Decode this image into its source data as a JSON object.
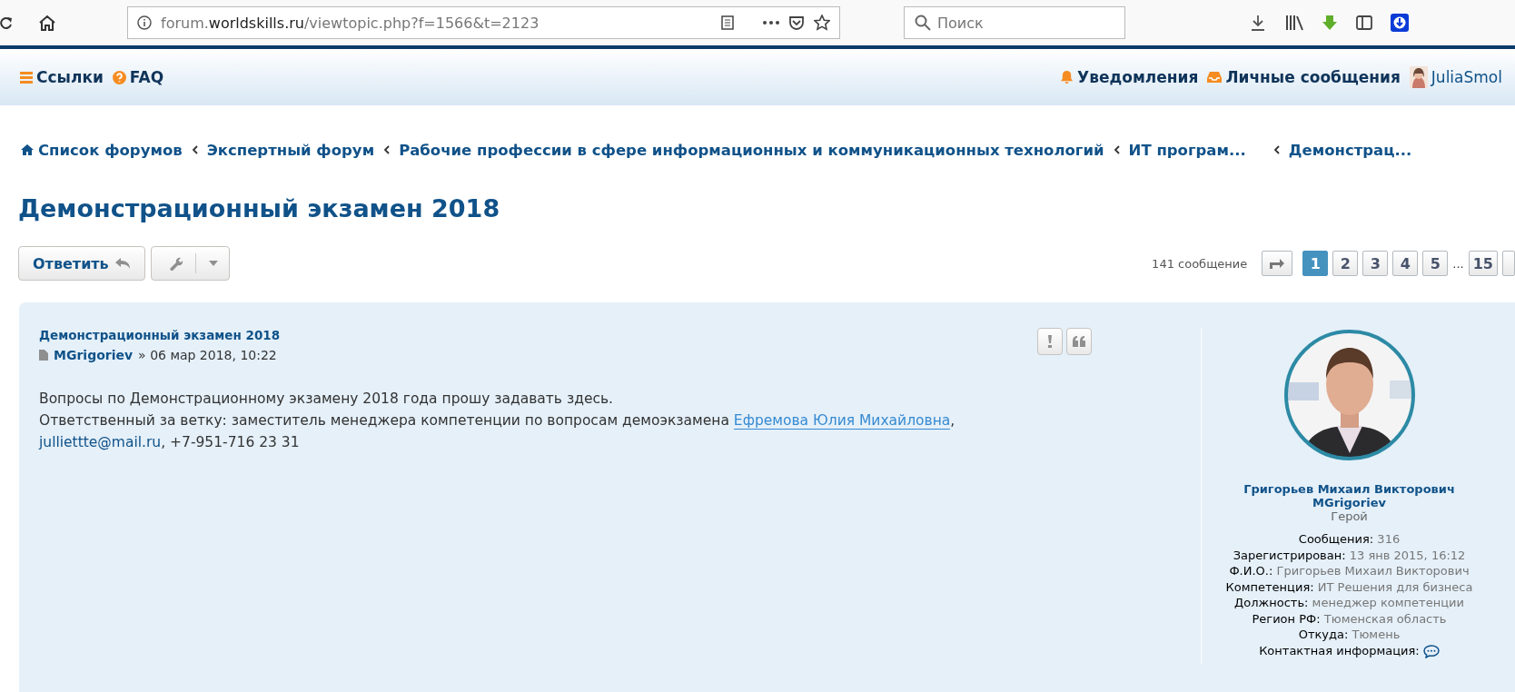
{
  "browser": {
    "url": {
      "prefix": "forum.",
      "domain": "worldskills.ru",
      "path": "/viewtopic.php?f=1566&t=2123"
    },
    "search": {
      "placeholder": "Поиск"
    }
  },
  "navbar": {
    "left": [
      {
        "kind": "menu",
        "label": "Ссылки"
      },
      {
        "kind": "help",
        "label": "FAQ"
      }
    ],
    "right": [
      {
        "kind": "bell",
        "label": "Уведомления"
      },
      {
        "kind": "inbox",
        "label": "Личные сообщения"
      },
      {
        "kind": "avatar",
        "label": "JuliaSmol"
      }
    ]
  },
  "breadcrumbs": [
    {
      "label": "Список форумов",
      "home": true
    },
    {
      "label": "Экспертный форум",
      "home": false
    },
    {
      "label": "Рабочие профессии в сфере информационных и коммуникационных технологий",
      "home": false
    },
    {
      "label": "ИТ програм...",
      "home": false
    },
    {
      "label": "Демонстрац...",
      "home": false
    }
  ],
  "title": "Демонстрационный экзамен 2018",
  "actions": {
    "reply": "Ответить",
    "count": "141 сообщение",
    "pages": [
      {
        "label": "1",
        "selected": true
      },
      {
        "label": "2",
        "selected": false
      },
      {
        "label": "3",
        "selected": false
      },
      {
        "label": "4",
        "selected": false
      },
      {
        "label": "5",
        "selected": false
      },
      {
        "label": "...",
        "kind": "gap"
      },
      {
        "label": "15",
        "selected": false
      }
    ]
  },
  "post": {
    "subject": "Демонстрационный экзамен 2018",
    "author": "MGrigoriev",
    "sep": "»",
    "date": "06 мар 2018, 10:22",
    "lines": [
      [
        {
          "kind": "text",
          "text": "Вопросы по Демонстрационному экзамену 2018 года прошу задавать здесь."
        }
      ],
      [
        {
          "kind": "text",
          "text": "Ответственный за ветку: заместитель менеджера компетенции по вопросам демоэкзамена "
        },
        {
          "kind": "mention",
          "text": "Ефремова Юлия Михайловна"
        },
        {
          "kind": "text",
          "text": ","
        }
      ],
      [
        {
          "kind": "link",
          "text": "julliettte@mail.ru"
        },
        {
          "kind": "text",
          "text": ", +7-951-716 23 31"
        }
      ]
    ],
    "profile": {
      "full_name": "Григорьев Михаил Викторович",
      "username": "MGrigoriev",
      "rank": "Герой",
      "fields": [
        {
          "label": "Сообщения:",
          "value": "316"
        },
        {
          "label": "Зарегистрирован:",
          "value": "13 янв 2015, 16:12"
        },
        {
          "label": "Ф.И.О.:",
          "value": "Григорьев Михаил Викторович"
        },
        {
          "label": "Компетенция:",
          "value": "ИТ Решения для бизнеса"
        },
        {
          "label": "Должность:",
          "value": "менеджер компетенции"
        },
        {
          "label": "Регион РФ:",
          "value": "Тюменская область"
        },
        {
          "label": "Откуда:",
          "value": "Тюмень"
        },
        {
          "label": "Контактная информация:",
          "kind": "contact"
        }
      ]
    }
  }
}
